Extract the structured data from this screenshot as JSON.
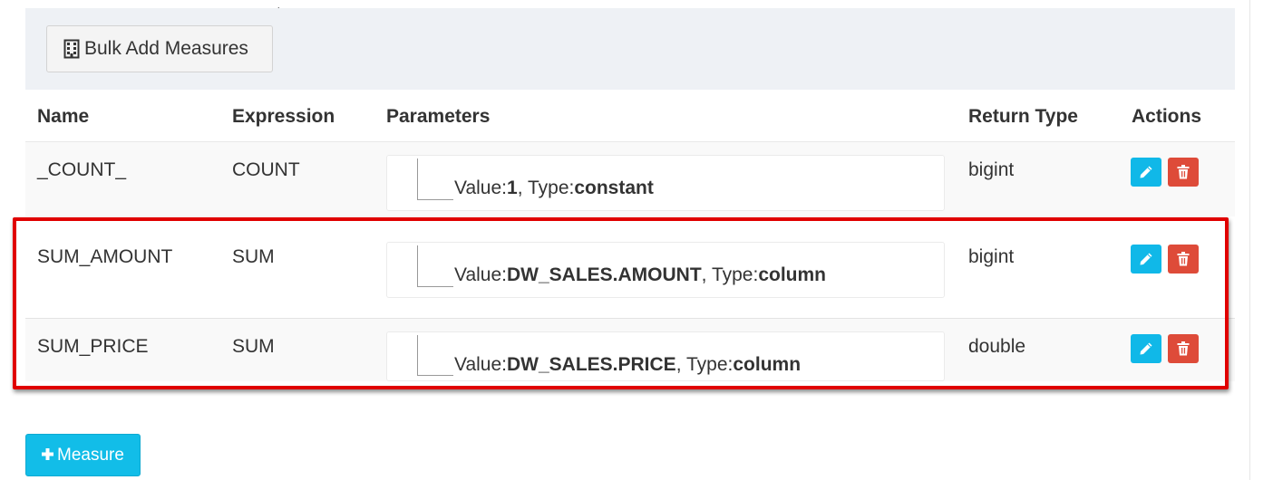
{
  "toolbar": {
    "bulk_add_label": "Bulk Add Measures",
    "bulk_add_icon": "building-icon"
  },
  "table": {
    "headers": [
      "Name",
      "Expression",
      "Parameters",
      "Return Type",
      "Actions"
    ],
    "rows": [
      {
        "name": "_COUNT_",
        "expression": "COUNT",
        "param_value_label": "Value:",
        "param_value": "1",
        "param_type_label": ", Type:",
        "param_type": "constant",
        "return_type": "bigint"
      },
      {
        "name": "SUM_AMOUNT",
        "expression": "SUM",
        "param_value_label": "Value:",
        "param_value": "DW_SALES.AMOUNT",
        "param_type_label": ", Type:",
        "param_type": "column",
        "return_type": "bigint"
      },
      {
        "name": "SUM_PRICE",
        "expression": "SUM",
        "param_value_label": "Value:",
        "param_value": "DW_SALES.PRICE",
        "param_type_label": ", Type:",
        "param_type": "column",
        "return_type": "double"
      }
    ],
    "action_icons": [
      "pencil-icon",
      "trash-icon"
    ]
  },
  "footer": {
    "add_measure_label": "Measure",
    "add_measure_icon": "plus-icon"
  },
  "colors": {
    "edit_button": "#10b8e8",
    "delete_button": "#de4b39",
    "add_button": "#12bde8",
    "highlight_border": "#e00000",
    "toolbar_bg": "#eef1f5"
  }
}
